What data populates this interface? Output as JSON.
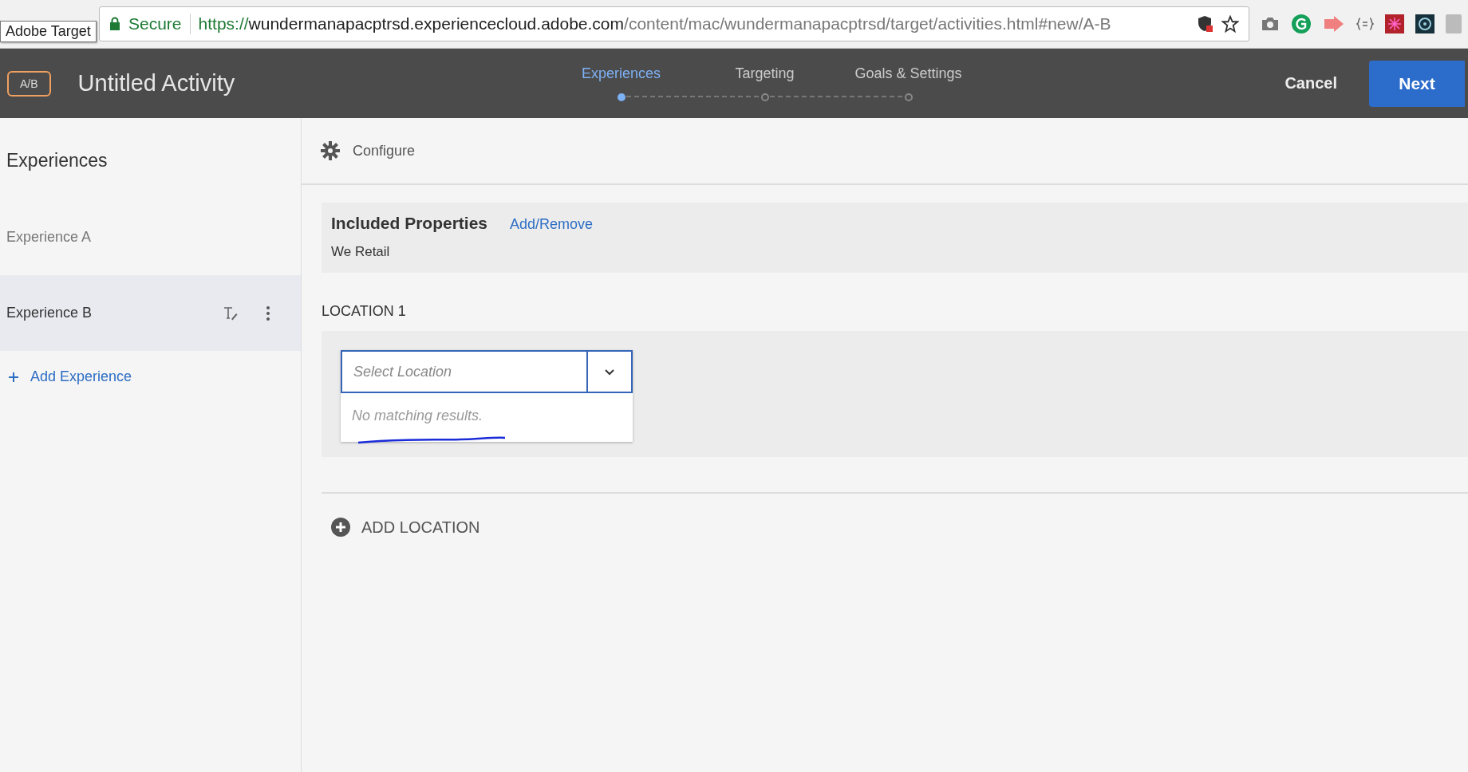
{
  "browser": {
    "tooltip": "Adobe Target",
    "secure_label": "Secure",
    "url_scheme": "https://",
    "url_host": "wundermanapacptrsd.experiencecloud.adobe.com",
    "url_path": "/content/mac/wundermanapacptrsd/target/activities.html#new/A-B"
  },
  "header": {
    "badge": "A/B",
    "title": "Untitled Activity",
    "steps": [
      {
        "label": "Experiences",
        "selected": true
      },
      {
        "label": "Targeting",
        "selected": false
      },
      {
        "label": "Goals & Settings",
        "selected": false
      }
    ],
    "cancel": "Cancel",
    "next": "Next"
  },
  "sidebar": {
    "title": "Experiences",
    "items": [
      {
        "label": "Experience A",
        "selected": false
      },
      {
        "label": "Experience B",
        "selected": true
      }
    ],
    "add": "Add Experience"
  },
  "main": {
    "configure": "Configure",
    "properties": {
      "title": "Included Properties",
      "link": "Add/Remove",
      "value": "We Retail"
    },
    "locations": [
      {
        "label": "LOCATION 1",
        "placeholder": "Select Location",
        "expanded": true,
        "empty_message": "No matching results."
      }
    ],
    "add_location": "ADD LOCATION"
  }
}
